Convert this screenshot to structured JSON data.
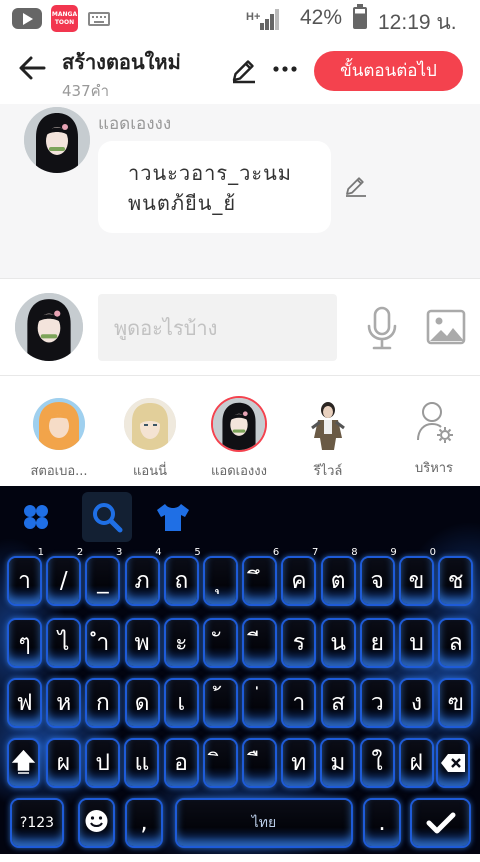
{
  "status_bar": {
    "app_label": "MANGA TOON",
    "signal_text": "H+",
    "battery_percent": "42%",
    "time": "12:19 น."
  },
  "header": {
    "title": "สร้างตอนใหม่",
    "word_count": "437คำ",
    "next_button": "ขั้นตอนต่อไป"
  },
  "chat": {
    "sender_name": "แอดเองงง",
    "message_line1": "าวนะวอาร_วะนม",
    "message_line2": "พนตภ้ยีน_ย้"
  },
  "input": {
    "placeholder": "พูดอะไรบ้าง",
    "value": ""
  },
  "characters": [
    {
      "name": "สตอเบอ..."
    },
    {
      "name": "แอนนี่"
    },
    {
      "name": "แอดเองงง"
    },
    {
      "name": "รีไวล์"
    }
  ],
  "manage_label": "บริหาร",
  "keyboard": {
    "row1": [
      "า",
      "/",
      "_",
      "ภ",
      "ถ",
      "ุ",
      "ึ",
      "ค",
      "ต",
      "จ",
      "ข",
      "ช"
    ],
    "row1_hints": [
      "1",
      "2",
      "3",
      "4",
      "5",
      "",
      "6",
      "7",
      "8",
      "9",
      "0",
      ""
    ],
    "row2": [
      "ๆ",
      "ไ",
      "ำ",
      "พ",
      "ะ",
      "ั",
      "ี",
      "ร",
      "น",
      "ย",
      "บ",
      "ล"
    ],
    "row3": [
      "ฟ",
      "ห",
      "ก",
      "ด",
      "เ",
      "้",
      "่",
      "า",
      "ส",
      "ว",
      "ง",
      "ฃ"
    ],
    "row4": [
      "ผ",
      "ป",
      "แ",
      "อ",
      "ิ",
      "ื",
      "ท",
      "ม",
      "ใ",
      "ฝ"
    ],
    "symbols_key": "?123",
    "comma_key": ",",
    "space_label": "ไทย",
    "period_key": "."
  }
}
